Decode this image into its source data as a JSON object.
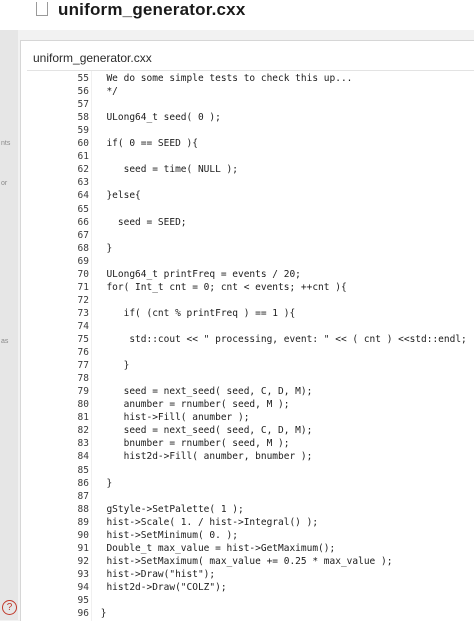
{
  "window": {
    "title": "uniform_generator.cxx"
  },
  "editor": {
    "tab_title": "uniform_generator.cxx",
    "lines": [
      {
        "num": "55",
        "text": "  We do some simple tests to check this up..."
      },
      {
        "num": "56",
        "text": "  */"
      },
      {
        "num": "57",
        "text": ""
      },
      {
        "num": "58",
        "text": "  ULong64_t seed( 0 );"
      },
      {
        "num": "59",
        "text": ""
      },
      {
        "num": "60",
        "text": "  if( 0 == SEED ){"
      },
      {
        "num": "61",
        "text": ""
      },
      {
        "num": "62",
        "text": "     seed = time( NULL );"
      },
      {
        "num": "63",
        "text": ""
      },
      {
        "num": "64",
        "text": "  }else{"
      },
      {
        "num": "65",
        "text": ""
      },
      {
        "num": "66",
        "text": "    seed = SEED;"
      },
      {
        "num": "67",
        "text": ""
      },
      {
        "num": "68",
        "text": "  }"
      },
      {
        "num": "69",
        "text": ""
      },
      {
        "num": "70",
        "text": "  ULong64_t printFreq = events / 20;"
      },
      {
        "num": "71",
        "text": "  for( Int_t cnt = 0; cnt < events; ++cnt ){"
      },
      {
        "num": "72",
        "text": ""
      },
      {
        "num": "73",
        "text": "     if( (cnt % printFreq ) == 1 ){"
      },
      {
        "num": "74",
        "text": ""
      },
      {
        "num": "75",
        "text": "      std::cout << \" processing, event: \" << ( cnt ) <<std::endl;"
      },
      {
        "num": "76",
        "text": ""
      },
      {
        "num": "77",
        "text": "     }"
      },
      {
        "num": "78",
        "text": ""
      },
      {
        "num": "79",
        "text": "     seed = next_seed( seed, C, D, M);"
      },
      {
        "num": "80",
        "text": "     anumber = rnumber( seed, M );"
      },
      {
        "num": "81",
        "text": "     hist->Fill( anumber );"
      },
      {
        "num": "82",
        "text": "     seed = next_seed( seed, C, D, M);"
      },
      {
        "num": "83",
        "text": "     bnumber = rnumber( seed, M );"
      },
      {
        "num": "84",
        "text": "     hist2d->Fill( anumber, bnumber );"
      },
      {
        "num": "85",
        "text": ""
      },
      {
        "num": "86",
        "text": "  }"
      },
      {
        "num": "87",
        "text": ""
      },
      {
        "num": "88",
        "text": "  gStyle->SetPalette( 1 );"
      },
      {
        "num": "89",
        "text": "  hist->Scale( 1. / hist->Integral() );"
      },
      {
        "num": "90",
        "text": "  hist->SetMinimum( 0. );"
      },
      {
        "num": "91",
        "text": "  Double_t max_value = hist->GetMaximum();"
      },
      {
        "num": "92",
        "text": "  hist->SetMaximum( max_value += 0.25 * max_value );"
      },
      {
        "num": "93",
        "text": "  hist->Draw(\"hist\");"
      },
      {
        "num": "94",
        "text": "  hist2d->Draw(\"COLZ\");"
      },
      {
        "num": "95",
        "text": ""
      },
      {
        "num": "96",
        "text": " }"
      }
    ]
  },
  "sidebar_fragments": [
    "nts",
    "or",
    "as"
  ],
  "help": {
    "label": "?"
  }
}
